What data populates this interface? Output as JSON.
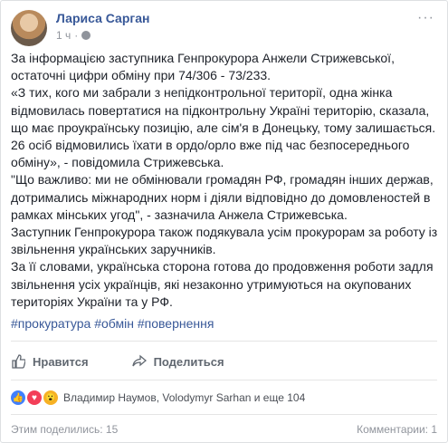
{
  "post": {
    "author": "Лариса Сарган",
    "time": "1 ч",
    "more": "···",
    "paragraphs": [
      "За інформацією заступника Генпрокурора Анжели Стрижевської, остаточні цифри обміну при 74/306 - 73/233.",
      "«З тих, кого ми забрали з непідконтрольної території, одна жінка відмовилась повертатися на підконтрольну Україні територію, сказала, що має проукраїнську позицію, але сім'я в Донецьку, тому залишається. 26 осіб відмовились їхати в ордо/орло вже під час безпосереднього обміну», - повідомила Стрижевська.",
      "\"Що важливо: ми не обмінювали громадян РФ, громадян інших держав, дотримались міжнародних норм і діяли відповідно до домовленостей в рамках мінських угод\", - зазначила Анжела Стрижевська.",
      "Заступник Генпрокурора також подякувала усім прокурорам за роботу із звільнення українських заручників.",
      "За її словами, українська сторона готова до продовження роботи задля звільнення усіх українців, які незаконно утримуються на окупованих територіях України та у РФ."
    ],
    "hashtags": [
      "#прокуратура",
      "#обмін",
      "#повернення"
    ]
  },
  "actions": {
    "like_label": "Нравится",
    "share_label": "Поделиться"
  },
  "reactions": {
    "names": "Владимир Наумов, Volodymyr Sarhan и еще 104",
    "icons": [
      "like-icon",
      "love-icon",
      "wow-icon"
    ]
  },
  "footer": {
    "shared": "Этим поделились: 15",
    "comments": "Комментарии: 1"
  }
}
